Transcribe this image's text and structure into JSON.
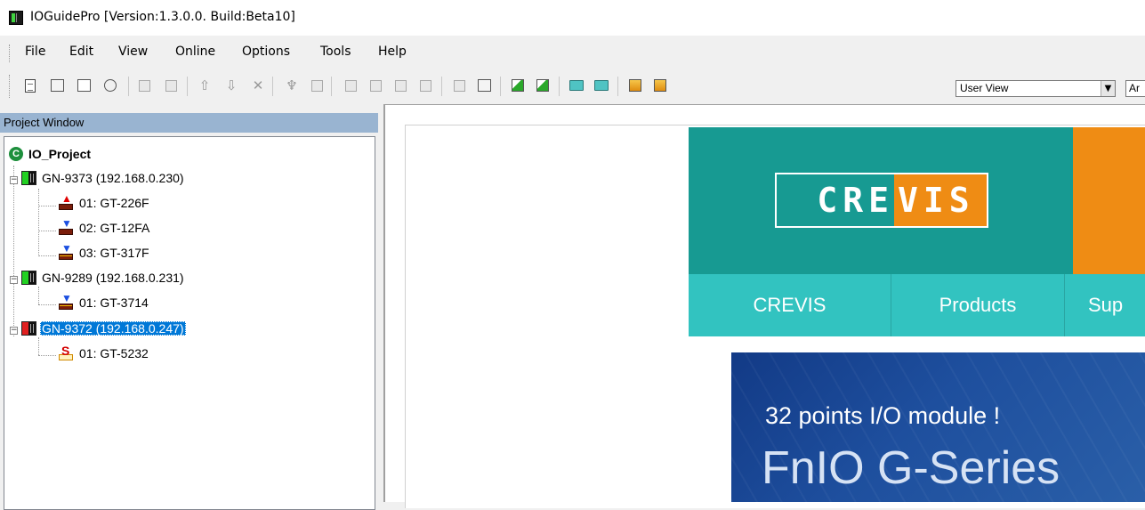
{
  "window": {
    "title": "IOGuidePro  [Version:1.3.0.0. Build:Beta10]"
  },
  "menu": [
    "File",
    "Edit",
    "View",
    "Online",
    "Options",
    "Tools",
    "Help"
  ],
  "toolbar": {
    "view_select_value": "User View",
    "second_select_value": "Ar"
  },
  "project_window": {
    "header": "Project Window",
    "root": "IO_Project",
    "nodes": [
      {
        "label": "GN-9373 (192.168.0.230)",
        "status": "green",
        "modules": [
          "01: GT-226F",
          "02: GT-12FA",
          "03: GT-317F"
        ]
      },
      {
        "label": "GN-9289 (192.168.0.231)",
        "status": "green",
        "modules": [
          "01: GT-3714"
        ]
      },
      {
        "label": "GN-9372 (192.168.0.247)",
        "status": "red",
        "selected": true,
        "modules": [
          "01: GT-5232"
        ]
      }
    ]
  },
  "web": {
    "logo_left": "CRE",
    "logo_right": "VIS",
    "nav": [
      "CREVIS",
      "Products",
      "Sup"
    ],
    "banner_small": "32 points I/O module !",
    "banner_big": "FnIO G-Series"
  },
  "colors": {
    "teal": "#179a92",
    "orange": "#ef8c14",
    "nav": "#32c3c0",
    "selection": "#0078d7"
  }
}
